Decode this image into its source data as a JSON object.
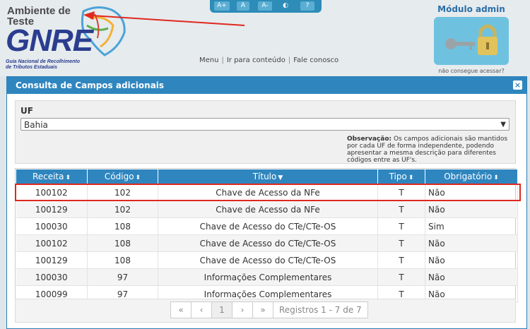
{
  "header": {
    "logo_env": "Ambiente de\nTeste",
    "logo_name": "GNRE",
    "logo_sub": "Guia Nacional de Recolhimento\nde Tributos Estaduais",
    "a11y": [
      "A+",
      "A",
      "A-",
      "◐",
      "?"
    ],
    "nav": [
      "Menu",
      "Ir para conteúdo",
      "Fale conosco"
    ],
    "admin_title": "Módulo admin",
    "admin_hint": "não consegue acessar?"
  },
  "modal": {
    "title": "Consulta de Campos adicionais",
    "close": "×",
    "uf_label": "UF",
    "uf_value": "Bahia",
    "obs_label": "Observação:",
    "obs_text": " Os campos adicionais são mantidos por cada UF de forma independente, podendo apresentar a mesma descrição para diferentes códigos entre as UF's."
  },
  "table": {
    "columns": [
      "Receita",
      "Código",
      "Título",
      "Tipo",
      "Obrigatório"
    ],
    "rows": [
      [
        "100102",
        "102",
        "Chave de Acesso da NFe",
        "T",
        "Não"
      ],
      [
        "100129",
        "102",
        "Chave de Acesso da NFe",
        "T",
        "Não"
      ],
      [
        "100030",
        "108",
        "Chave de Acesso do CTe/CTe-OS",
        "T",
        "Sim"
      ],
      [
        "100102",
        "108",
        "Chave de Acesso do CTe/CTe-OS",
        "T",
        "Não"
      ],
      [
        "100129",
        "108",
        "Chave de Acesso do CTe/CTe-OS",
        "T",
        "Não"
      ],
      [
        "100030",
        "97",
        "Informações Complementares",
        "T",
        "Não"
      ],
      [
        "100099",
        "97",
        "Informações Complementares",
        "T",
        "Não"
      ]
    ]
  },
  "pager": {
    "first": "«",
    "prev": "‹",
    "page": "1",
    "next": "›",
    "last": "»",
    "info": "Registros 1 - 7 de 7"
  },
  "colors": {
    "accent": "#2f86bf",
    "highlight": "#e0281f"
  }
}
